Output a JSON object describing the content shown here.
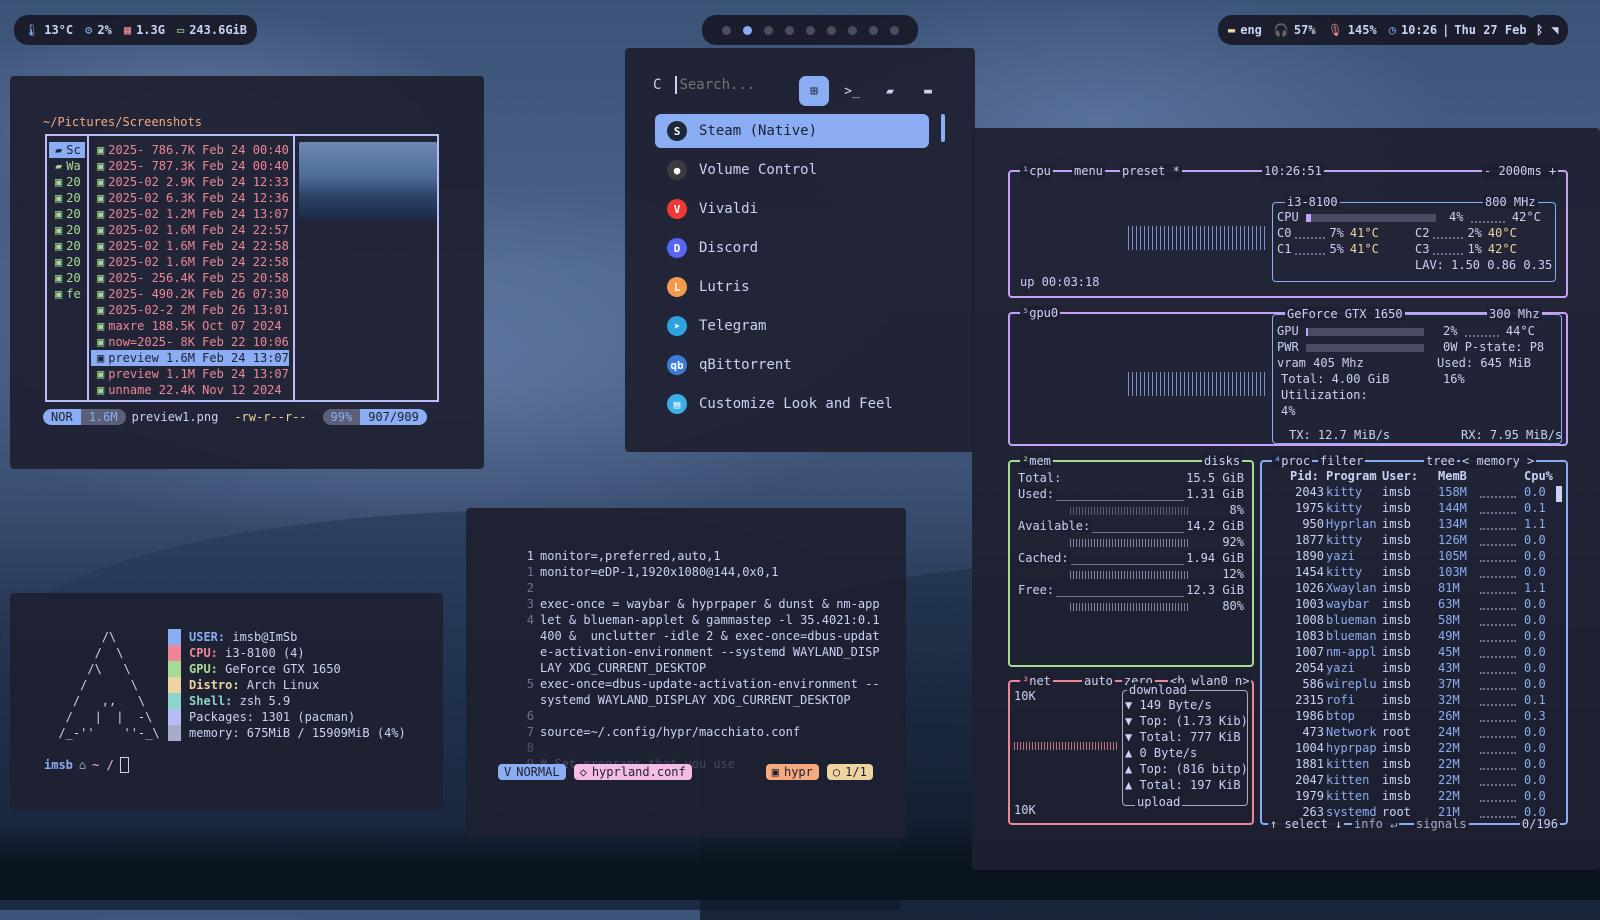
{
  "bar": {
    "left": {
      "temp": "13°C",
      "cpu": "2%",
      "ram": "1.3G",
      "disk": "243.6GiB"
    },
    "workspaces": 9,
    "active_workspace": 2,
    "right": {
      "lang": "eng",
      "volume": "57%",
      "mic": "145%",
      "time": "10:26",
      "sep": "|",
      "date": "Thu 27 Feb"
    }
  },
  "yazi": {
    "path": "~/Pictures/Screenshots",
    "parent": [
      "Sc",
      "Wa",
      "20",
      "20",
      "20",
      "20",
      "20",
      "20",
      "20",
      "fe"
    ],
    "files": [
      {
        "name": "2025- 786.7K Feb 24 00:40"
      },
      {
        "name": "2025- 787.3K Feb 24 00:40"
      },
      {
        "name": "2025-02 2.9K Feb 24 12:33"
      },
      {
        "name": "2025-02 6.3K Feb 24 12:36"
      },
      {
        "name": "2025-02 1.2M Feb 24 13:07"
      },
      {
        "name": "2025-02 1.6M Feb 24 22:57"
      },
      {
        "name": "2025-02 1.6M Feb 24 22:58"
      },
      {
        "name": "2025-02 1.6M Feb 24 22:58"
      },
      {
        "name": "2025- 256.4K Feb 25 20:58"
      },
      {
        "name": "2025- 490.2K Feb 26 07:30"
      },
      {
        "name": "2025-02-2 2M Feb 26 13:01"
      },
      {
        "name": "maxre 188.5K Oct 07  2024"
      },
      {
        "name": "now=2025- 8K Feb 22 10:06"
      },
      {
        "name": "preview 1.6M Feb 24 13:07"
      },
      {
        "name": "preview 1.1M Feb 24 13:07"
      },
      {
        "name": "unname 22.4K Nov 12  2024"
      }
    ],
    "status": {
      "mode": "NOR",
      "size": "1.6M",
      "file": "preview1.png",
      "perms": "-rw-r--r--",
      "pct": "99%",
      "pos": "907/909"
    }
  },
  "fastfetch": {
    "art": "        /\\\n       /  \\\n      /\\   \\\n     /      \\\n    /   ,,   \\\n   /   |  |  -\\\n  /_-''    ''-_\\",
    "rows": [
      {
        "key": "USER:",
        "val": "imsb@ImSb",
        "color": "#8aadf4"
      },
      {
        "key": "CPU:",
        "val": "i3-8100 (4)",
        "color": "#ed8796"
      },
      {
        "key": "GPU:",
        "val": "GeForce GTX 1650",
        "color": "#a6da95"
      },
      {
        "key": "Distro:",
        "val": "Arch Linux",
        "color": "#eed49f"
      },
      {
        "key": "Shell:",
        "val": "zsh 5.9",
        "color": "#8bd5ca"
      },
      {
        "key": "",
        "val": "Packages: 1301 (pacman)",
        "color": "#b7bdf8"
      },
      {
        "key": "",
        "val": "memory: 675MiB / 15909MiB (4%)",
        "color": "#a5adcb"
      }
    ],
    "prompt": {
      "user": "imsb",
      "path": "~ /"
    }
  },
  "launcher": {
    "prefix": "C",
    "placeholder": "Search...",
    "apps": [
      {
        "name": "Steam (Native)",
        "icon": "steam-icon",
        "color": "#1b2838",
        "glyph": "S"
      },
      {
        "name": "Volume Control",
        "icon": "volume-control-icon",
        "color": "#3b3b3b",
        "glyph": "●"
      },
      {
        "name": "Vivaldi",
        "icon": "vivaldi-icon",
        "color": "#ef3939",
        "glyph": "V"
      },
      {
        "name": "Discord",
        "icon": "discord-icon",
        "color": "#5865f2",
        "glyph": "D"
      },
      {
        "name": "Lutris",
        "icon": "lutris-icon",
        "color": "#f29b4b",
        "glyph": "L"
      },
      {
        "name": "Telegram",
        "icon": "telegram-icon",
        "color": "#2aa3e0",
        "glyph": "➤"
      },
      {
        "name": "qBittorrent",
        "icon": "qbittorrent-icon",
        "color": "#3e7bd6",
        "glyph": "qb"
      },
      {
        "name": "Customize Look and Feel",
        "icon": "customize-look-icon",
        "color": "#3daee9",
        "glyph": "▤"
      }
    ]
  },
  "nvim": {
    "lines": [
      {
        "n": "1",
        "text": "monitor=,preferred,auto,1"
      },
      {
        "n": "1",
        "text": "monitor=eDP-1,1920x1080@144,0x0,1"
      },
      {
        "n": "2",
        "text": ""
      },
      {
        "n": "3",
        "text": "exec-once = waybar & hyprpaper & dunst & nm-app"
      },
      {
        "n": "4",
        "text": "let & blueman-applet & gammastep -l 35.4021:0.1"
      },
      {
        "n": "",
        "text": "400 &  unclutter -idle 2 & exec-once=dbus-updat"
      },
      {
        "n": "",
        "text": "e-activation-environment --systemd WAYLAND_DISP"
      },
      {
        "n": "",
        "text": "LAY XDG_CURRENT_DESKTOP"
      },
      {
        "n": "5",
        "text": "exec-once=dbus-update-activation-environment --"
      },
      {
        "n": "",
        "text": "systemd WAYLAND_DISPLAY XDG_CURRENT_DESKTOP"
      },
      {
        "n": "6",
        "text": ""
      },
      {
        "n": "7",
        "text": "source=~/.config/hypr/macchiato.conf"
      },
      {
        "n": "8",
        "text": ""
      },
      {
        "n": "9",
        "text": "# Set programs that you use"
      }
    ],
    "status": {
      "mode": "NORMAL",
      "file": "hyprland.conf",
      "ft": "hypr",
      "pos": "1/1"
    }
  },
  "btop": {
    "cpu": {
      "title": "cpu",
      "menu": "menu",
      "preset": "preset *",
      "clock": "10:26:51",
      "rate": "- 2000ms +",
      "model": "i3-8100",
      "freq": "800 MHz",
      "uptime": "up 00:03:18",
      "total": {
        "label": "CPU",
        "pct": "4%",
        "pct_val": 4,
        "temp": "42°C"
      },
      "cores": [
        {
          "label": "C0",
          "pct": "7%",
          "temp": "41°C"
        },
        {
          "label": "C2",
          "pct": "2%",
          "temp": "40°C"
        },
        {
          "label": "C1",
          "pct": "5%",
          "temp": "41°C"
        },
        {
          "label": "C3",
          "pct": "1%",
          "temp": "42°C"
        }
      ],
      "lav": "LAV: 1.50 0.86 0.35"
    },
    "gpu": {
      "title": "gpu0",
      "model": "GeForce GTX 1650",
      "freq": "300 Mhz",
      "gpu_pct": "2%",
      "gpu_pct_val": 2,
      "gpu_temp": "44°C",
      "pwr": "0W",
      "pstate": "P-state:  P8",
      "vram_label": "vram",
      "vram_clock": "405 Mhz",
      "used_label": "Used:",
      "used": "645 MiB",
      "total_label": "Total:",
      "total": "4.00 GiB",
      "util_label": "Utilization:",
      "util": "4%",
      "used_pct": "16%",
      "tx": "TX: 12.7 MiB/s",
      "rx": "RX: 7.95 MiB/s"
    },
    "mem": {
      "title": "mem",
      "disks": "disks",
      "total": "15.5 GiB",
      "rows": [
        {
          "label": "Used:",
          "val": "1.31 GiB",
          "pct": "8%"
        },
        {
          "label": "Available:",
          "val": "14.2 GiB",
          "pct": "92%"
        },
        {
          "label": "Cached:",
          "val": "1.94 GiB",
          "pct": "12%"
        },
        {
          "label": "Free:",
          "val": "12.3 GiB",
          "pct": "80%"
        }
      ]
    },
    "net": {
      "title": "net",
      "auto": "auto",
      "zero": "zero",
      "iface": "<b wlan0 n>",
      "scale_top": "10K",
      "scale_bot": "10K",
      "download": "download",
      "d_rate": "▼ 149 Byte/s",
      "d_top": "▼ Top: (1.73 Kib)",
      "d_total": "▼ Total:  777 KiB",
      "u_rate": "▲ 0 Byte/s",
      "u_top": "▲ Top: (816 bitp)",
      "u_total": "▲ Total:  197 KiB",
      "upload": "upload"
    },
    "proc": {
      "title": "proc",
      "filter": "filter",
      "tree": "tree",
      "sort": "< memory >",
      "headers": [
        "Pid:",
        "Program",
        "User:",
        "MemB",
        "Cpu%"
      ],
      "rows": [
        {
          "pid": "2043",
          "prog": "kitty",
          "user": "imsb",
          "mem": "158M",
          "cpu": "0.0"
        },
        {
          "pid": "1975",
          "prog": "kitty",
          "user": "imsb",
          "mem": "144M",
          "cpu": "0.1"
        },
        {
          "pid": "950",
          "prog": "Hyprlan",
          "user": "imsb",
          "mem": "134M",
          "cpu": "1.1"
        },
        {
          "pid": "1877",
          "prog": "kitty",
          "user": "imsb",
          "mem": "126M",
          "cpu": "0.0"
        },
        {
          "pid": "1890",
          "prog": "yazi",
          "user": "imsb",
          "mem": "105M",
          "cpu": "0.0"
        },
        {
          "pid": "1454",
          "prog": "kitty",
          "user": "imsb",
          "mem": "103M",
          "cpu": "0.0"
        },
        {
          "pid": "1026",
          "prog": "Xwaylan",
          "user": "imsb",
          "mem": "81M",
          "cpu": "1.1"
        },
        {
          "pid": "1003",
          "prog": "waybar",
          "user": "imsb",
          "mem": "63M",
          "cpu": "0.0"
        },
        {
          "pid": "1008",
          "prog": "blueman",
          "user": "imsb",
          "mem": "58M",
          "cpu": "0.0"
        },
        {
          "pid": "1083",
          "prog": "blueman",
          "user": "imsb",
          "mem": "49M",
          "cpu": "0.0"
        },
        {
          "pid": "1007",
          "prog": "nm-appl",
          "user": "imsb",
          "mem": "45M",
          "cpu": "0.0"
        },
        {
          "pid": "2054",
          "prog": "yazi",
          "user": "imsb",
          "mem": "43M",
          "cpu": "0.0"
        },
        {
          "pid": "586",
          "prog": "wireplu",
          "user": "imsb",
          "mem": "37M",
          "cpu": "0.0"
        },
        {
          "pid": "2315",
          "prog": "rofi",
          "user": "imsb",
          "mem": "32M",
          "cpu": "0.1"
        },
        {
          "pid": "1986",
          "prog": "btop",
          "user": "imsb",
          "mem": "26M",
          "cpu": "0.3"
        },
        {
          "pid": "473",
          "prog": "Network",
          "user": "root",
          "mem": "24M",
          "cpu": "0.0"
        },
        {
          "pid": "1004",
          "prog": "hyprpap",
          "user": "imsb",
          "mem": "22M",
          "cpu": "0.0"
        },
        {
          "pid": "1881",
          "prog": "kitten",
          "user": "imsb",
          "mem": "22M",
          "cpu": "0.0"
        },
        {
          "pid": "2047",
          "prog": "kitten",
          "user": "imsb",
          "mem": "22M",
          "cpu": "0.0"
        },
        {
          "pid": "1979",
          "prog": "kitten",
          "user": "imsb",
          "mem": "22M",
          "cpu": "0.0"
        },
        {
          "pid": "263",
          "prog": "systemd",
          "user": "root",
          "mem": "21M",
          "cpu": "0.0"
        }
      ],
      "footer": {
        "select": "↑ select ↓",
        "info": "info ↵",
        "signals": "signals",
        "count": "0/196"
      }
    },
    "colors": {
      "cpu": "#c6a0f6",
      "gpu": "#c6a0f6",
      "mem": "#a6da95",
      "net": "#ed8796",
      "proc": "#8aadf4"
    }
  }
}
